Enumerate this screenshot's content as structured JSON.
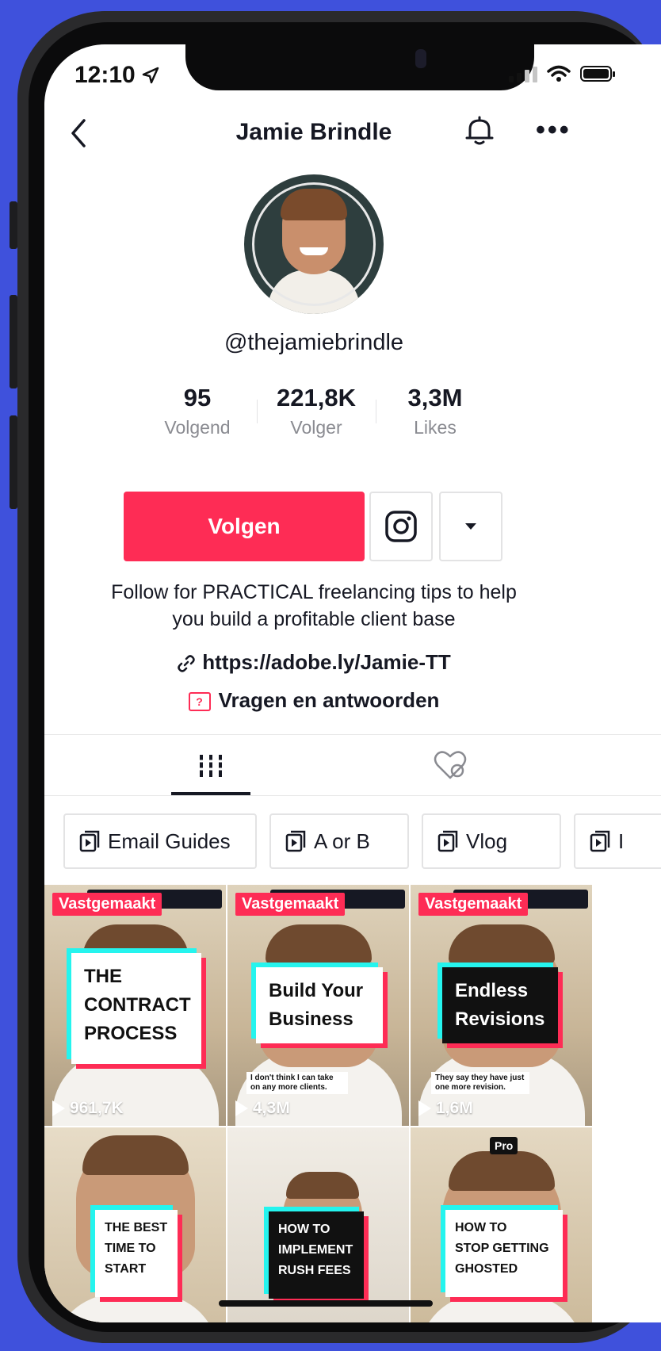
{
  "status": {
    "time": "12:10"
  },
  "header": {
    "title": "Jamie Brindle"
  },
  "profile": {
    "handle": "@thejamiebrindle",
    "stats": [
      {
        "value": "95",
        "label": "Volgend"
      },
      {
        "value": "221,8K",
        "label": "Volger"
      },
      {
        "value": "3,3M",
        "label": "Likes"
      }
    ],
    "follow_label": "Volgen",
    "bio_line1": "Follow for PRACTICAL freelancing tips to help",
    "bio_line2": "you build a profitable client base",
    "link": "https://adobe.ly/Jamie-TT",
    "qa_label": "Vragen en antwoorden"
  },
  "playlists": [
    "Email Guides",
    "A or B",
    "Vlog",
    "I"
  ],
  "videos": [
    {
      "pinned": "Vastgemaakt",
      "title_line1": "THE",
      "title_line2": "CONTRACT",
      "title_line3": "PROCESS",
      "caption": "",
      "views": "961,7K"
    },
    {
      "pinned": "Vastgemaakt",
      "title_line1": "Build Your",
      "title_line2": "Business",
      "title_line3": "",
      "caption": "I don't think I can take on any more clients.",
      "views": "4,3M"
    },
    {
      "pinned": "Vastgemaakt",
      "title_line1": "Endless",
      "title_line2": "Revisions",
      "title_line3": "",
      "caption": "They say they have just one more revision.",
      "views": "1,6M"
    },
    {
      "title_line1": "THE BEST",
      "title_line2": "TIME TO",
      "title_line3": "START"
    },
    {
      "title_line1": "HOW TO",
      "title_line2": "IMPLEMENT",
      "title_line3": "RUSH FEES"
    },
    {
      "badge": "Pro",
      "title_line1": "HOW TO",
      "title_line2": "STOP GETTING",
      "title_line3": "GHOSTED"
    }
  ],
  "colors": {
    "brand_red": "#fe2c55",
    "accent_cyan": "#25f4ee",
    "background": "#3f51dc"
  }
}
